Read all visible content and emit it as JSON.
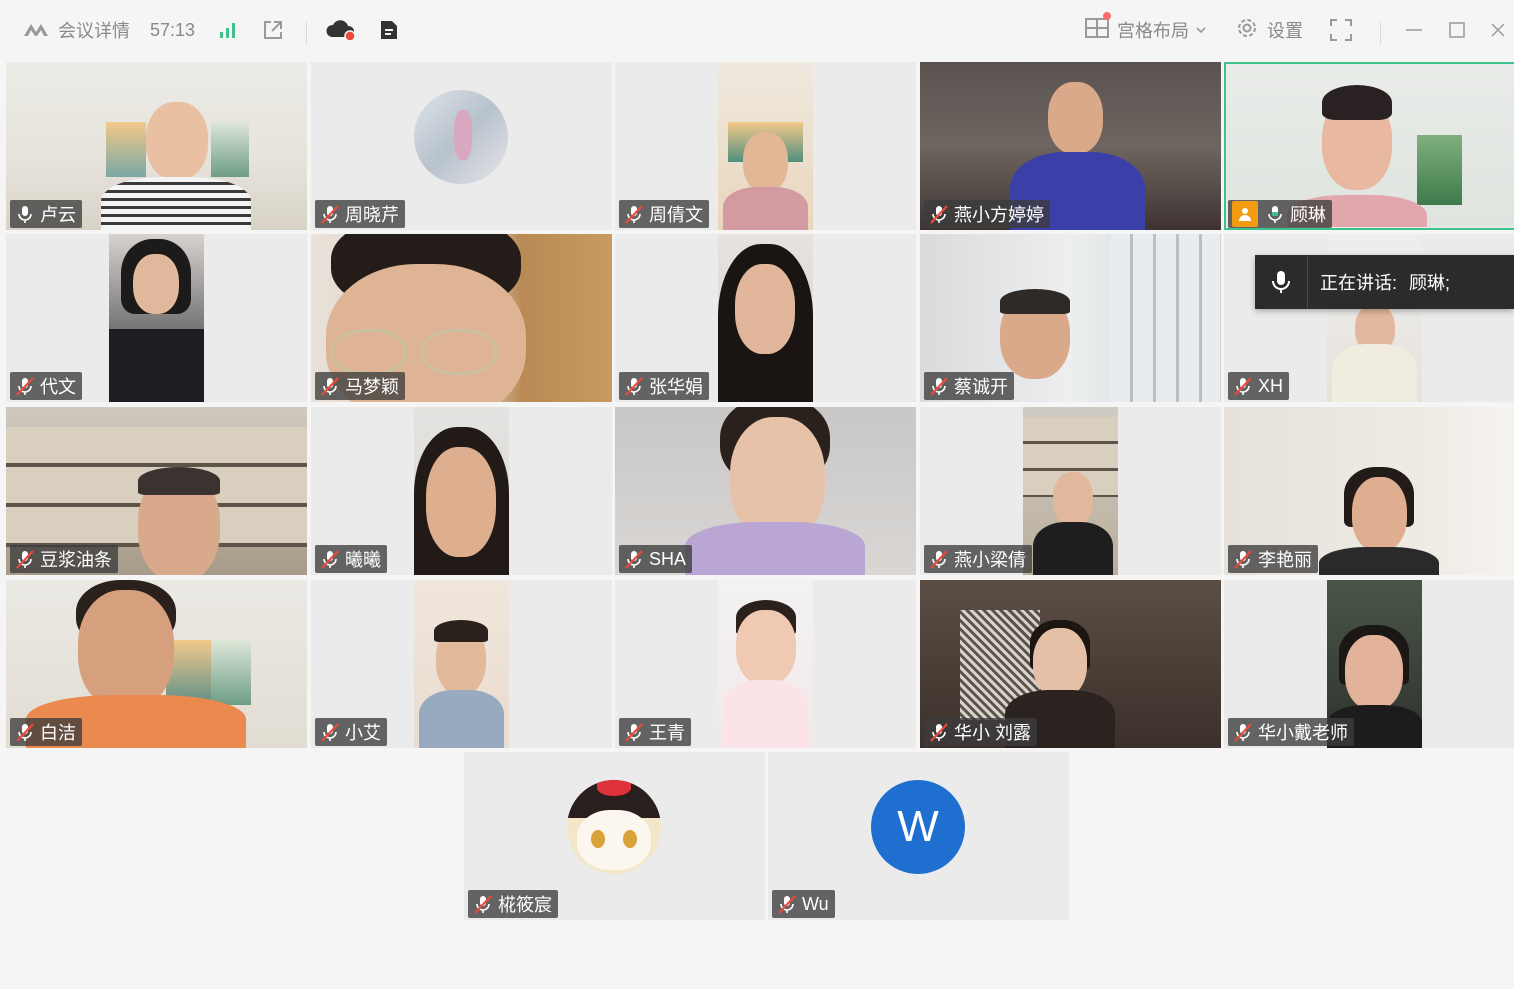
{
  "toolbar": {
    "meeting_details": "会议详情",
    "timer": "57:13",
    "grid_layout": "宫格布局",
    "settings": "设置"
  },
  "speaking": {
    "label": "正在讲话:",
    "names": "顾琳;"
  },
  "participants": [
    {
      "name": "卢云"
    },
    {
      "name": "周晓芹"
    },
    {
      "name": "周倩文"
    },
    {
      "name": "燕小方婷婷"
    },
    {
      "name": "顾琳"
    },
    {
      "name": "代文"
    },
    {
      "name": "马梦颖"
    },
    {
      "name": "张华娟"
    },
    {
      "name": "蔡诚开"
    },
    {
      "name": "XH"
    },
    {
      "name": "豆浆油条"
    },
    {
      "name": "曦曦"
    },
    {
      "name": "SHA"
    },
    {
      "name": "燕小梁倩"
    },
    {
      "name": "李艳丽"
    },
    {
      "name": "白洁"
    },
    {
      "name": "小艾"
    },
    {
      "name": "王青"
    },
    {
      "name": "华小 刘露"
    },
    {
      "name": "华小戴老师"
    },
    {
      "name": "椛筱宸"
    },
    {
      "name": "Wu",
      "avatar_letter": "W"
    }
  ],
  "colors": {
    "active_border": "#3cc28a",
    "avatar_blue": "#1e6fcf",
    "host_badge": "#f39c12",
    "muted_red": "#e84b3c"
  }
}
